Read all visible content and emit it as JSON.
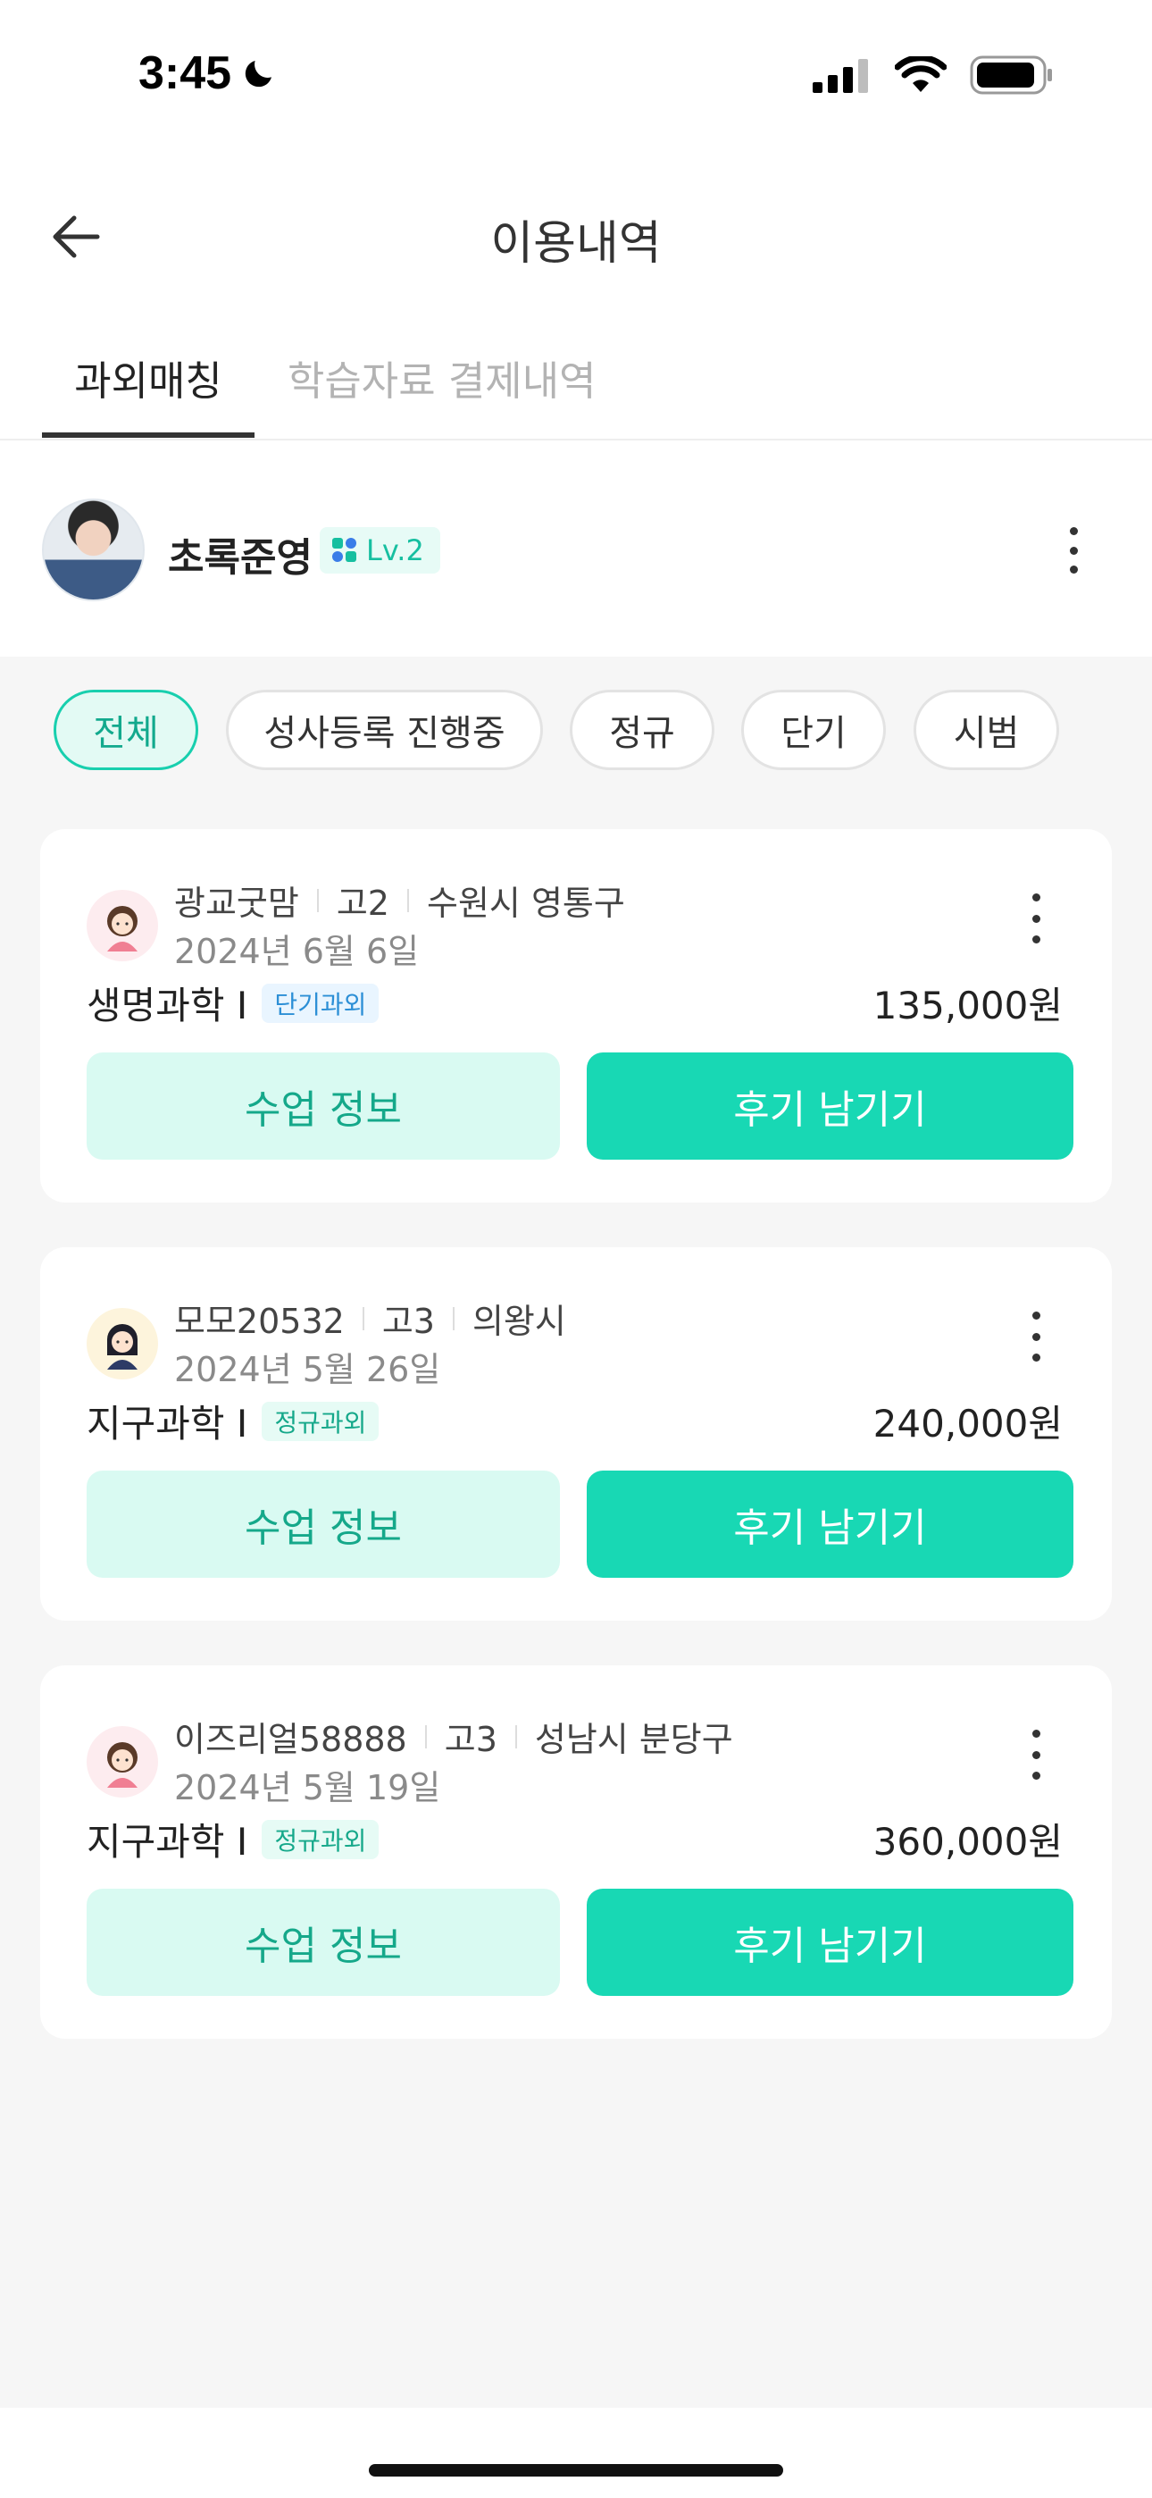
{
  "status_bar": {
    "time": "3:45"
  },
  "header": {
    "title": "이용내역"
  },
  "tabs": [
    {
      "label": "과외매칭",
      "active": true
    },
    {
      "label": "학습자료 결제내역",
      "active": false
    }
  ],
  "profile": {
    "name": "초록준영",
    "level": "Lv.2"
  },
  "filters": [
    {
      "label": "전체",
      "active": true
    },
    {
      "label": "성사등록 진행중",
      "active": false
    },
    {
      "label": "정규",
      "active": false
    },
    {
      "label": "단기",
      "active": false
    },
    {
      "label": "시범",
      "active": false
    }
  ],
  "cards": [
    {
      "nickname": "광교굿맘",
      "grade": "고2",
      "location": "수원시 영통구",
      "date": "2024년 6월 6일",
      "subject": "생명과학 I",
      "tag": "단기과외",
      "price": "135,000원",
      "info_label": "수업 정보",
      "review_label": "후기 남기기"
    },
    {
      "nickname": "모모20532",
      "grade": "고3",
      "location": "의왕시",
      "date": "2024년 5월 26일",
      "subject": "지구과학 I",
      "tag": "정규과외",
      "price": "240,000원",
      "info_label": "수업 정보",
      "review_label": "후기 남기기"
    },
    {
      "nickname": "이즈리얼58888",
      "grade": "고3",
      "location": "성남시 분당구",
      "date": "2024년 5월 19일",
      "subject": "지구과학 I",
      "tag": "정규과외",
      "price": "360,000원",
      "info_label": "수업 정보",
      "review_label": "후기 남기기"
    }
  ],
  "colors": {
    "accent": "#18d8b4",
    "accent_light": "#d9faf2",
    "accent_text": "#15a88a",
    "background": "#f6f6f6"
  }
}
